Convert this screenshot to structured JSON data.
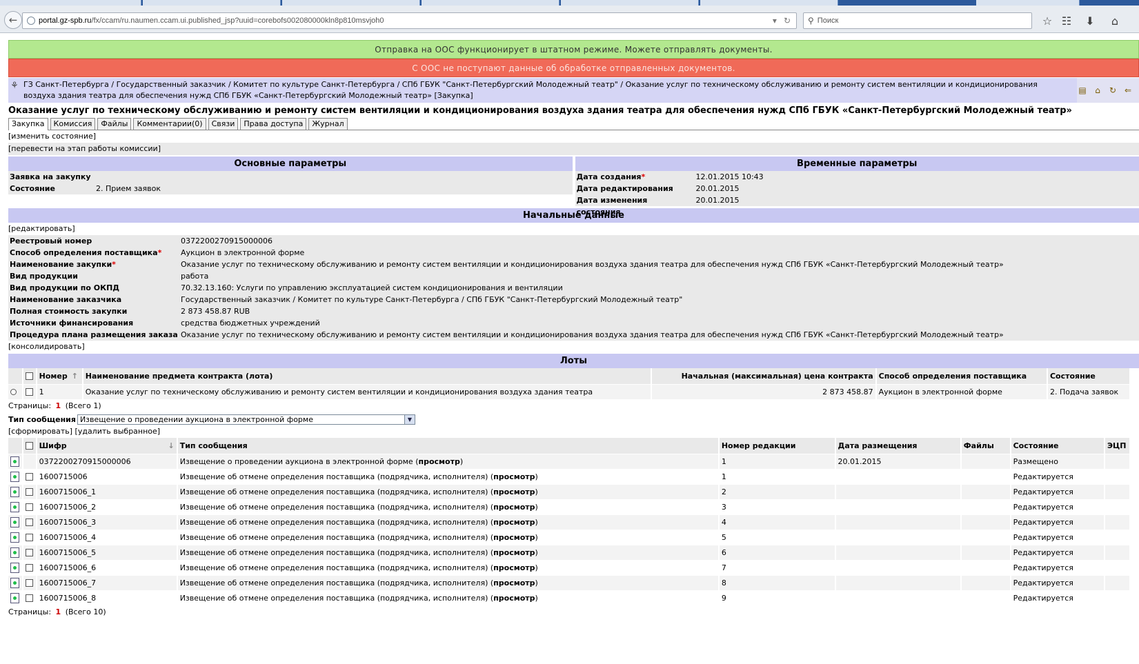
{
  "browser": {
    "url_host": "portal.gz-spb.ru",
    "url_path": "/fx/ccam/ru.naumen.ccam.ui.published_jsp?uuid=corebofs002080000kln8p810msvjoh0",
    "search_placeholder": "Поиск"
  },
  "banners": {
    "ok": "Отправка на ООС функционирует в штатном режиме. Можете отправлять документы.",
    "error": "С ООС не поступают данные об обработке отправленных документов."
  },
  "breadcrumb": "ГЗ Санкт-Петербурга / Государственный заказчик / Комитет по культуре Санкт-Петербурга / СПб ГБУК \"Санкт-Петербургский Молодежный театр\" / Оказание услуг по техническому обслуживанию и ремонту систем вентиляции и кондиционирования воздуха здания театра для обеспечения нужд СПб ГБУК «Санкт-Петербургский Молодежный театр» [Закупка]",
  "page_title": "Оказание услуг по техническому обслуживанию и ремонту систем вентиляции и кондиционирования воздуха здания театра для обеспечения нужд СПб ГБУК «Санкт-Петербургский Молодежный театр»",
  "tabs": [
    "Закупка",
    "Комиссия",
    "Файлы",
    "Комментарии(0)",
    "Связи",
    "Права доступа",
    "Журнал"
  ],
  "actions": {
    "change_state": "[изменить состояние]",
    "to_commission": "[перевести на этап работы комиссии]",
    "edit": "[редактировать]",
    "consolidate": "[консолидировать]",
    "generate": "[сформировать]",
    "delete_selected": "[удалить выбранное]"
  },
  "main_params": {
    "title": "Основные параметры",
    "rows": [
      {
        "k": "Заявка на закупку",
        "v": ""
      },
      {
        "k": "Состояние",
        "v": "2. Прием заявок"
      }
    ]
  },
  "time_params": {
    "title": "Временные параметры",
    "rows": [
      {
        "k": "Дата создания",
        "v": "12.01.2015 10:43",
        "req": true
      },
      {
        "k": "Дата редактирования",
        "v": "20.01.2015"
      },
      {
        "k": "Дата изменения состояния",
        "v": "20.01.2015"
      }
    ]
  },
  "initial": {
    "title": "Начальные данные",
    "rows": [
      {
        "k": "Реестровый номер",
        "v": "0372200270915000006"
      },
      {
        "k": "Способ определения поставщика",
        "v": "Аукцион в электронной форме",
        "req": true
      },
      {
        "k": "Наименование закупки",
        "v": "Оказание услуг по техническому обслуживанию и ремонту систем вентиляции и кондиционирования воздуха здания театра для обеспечения нужд СПб ГБУК «Санкт-Петербургский Молодежный театр»",
        "req": true
      },
      {
        "k": "Вид продукции",
        "v": "работа"
      },
      {
        "k": "Вид продукции по ОКПД",
        "v": "70.32.13.160: Услуги по управлению эксплуатацией систем кондиционирования и вентиляции"
      },
      {
        "k": "Наименование заказчика",
        "v": "Государственный заказчик / Комитет по культуре Санкт-Петербурга / СПб ГБУК \"Санкт-Петербургский Молодежный театр\""
      },
      {
        "k": "Полная стоимость закупки",
        "v": "2 873 458.87 RUB"
      },
      {
        "k": "Источники финансирования",
        "v": "средства бюджетных учреждений"
      },
      {
        "k": "Процедура плана размещения заказа",
        "v": "Оказание услуг по техническому обслуживанию и ремонту систем вентиляции и кондиционирования воздуха здания театра для обеспечения нужд СПб ГБУК «Санкт-Петербургский Молодежный театр»"
      }
    ]
  },
  "lots": {
    "title": "Лоты",
    "headers": [
      "Номер",
      "Наименование предмета контракта (лота)",
      "Начальная (максимальная) цена контракта",
      "Способ определения поставщика",
      "Состояние"
    ],
    "rows": [
      {
        "num": "1",
        "name": "Оказание услуг по техническому обслуживанию и ремонту систем вентиляции и кондиционирования воздуха здания театра",
        "price": "2 873 458.87",
        "method": "Аукцион в электронной форме",
        "state": "2. Подача заявок"
      }
    ],
    "pager": {
      "label": "Страницы:",
      "current": "1",
      "total": "(Всего 1)"
    }
  },
  "message_type": {
    "label": "Тип сообщения",
    "selected": "Извещение о проведении аукциона в электронной форме"
  },
  "messages": {
    "headers": [
      "Шифр",
      "Тип сообщения",
      "Номер редакции",
      "Дата размещения",
      "Файлы",
      "Состояние",
      "ЭЦП"
    ],
    "view_label": "просмотр",
    "rows": [
      {
        "code": "0372200270915000006",
        "type": "Извещение о проведении аукциона в электронной форме",
        "rev": "1",
        "date": "20.01.2015",
        "state": "Размещено",
        "checkbox": false
      },
      {
        "code": "1600715006",
        "type": "Извещение об отмене определения поставщика (подрядчика, исполнителя)",
        "rev": "1",
        "date": "",
        "state": "Редактируется",
        "checkbox": true
      },
      {
        "code": "1600715006_1",
        "type": "Извещение об отмене определения поставщика (подрядчика, исполнителя)",
        "rev": "2",
        "date": "",
        "state": "Редактируется",
        "checkbox": true
      },
      {
        "code": "1600715006_2",
        "type": "Извещение об отмене определения поставщика (подрядчика, исполнителя)",
        "rev": "3",
        "date": "",
        "state": "Редактируется",
        "checkbox": true
      },
      {
        "code": "1600715006_3",
        "type": "Извещение об отмене определения поставщика (подрядчика, исполнителя)",
        "rev": "4",
        "date": "",
        "state": "Редактируется",
        "checkbox": true
      },
      {
        "code": "1600715006_4",
        "type": "Извещение об отмене определения поставщика (подрядчика, исполнителя)",
        "rev": "5",
        "date": "",
        "state": "Редактируется",
        "checkbox": true
      },
      {
        "code": "1600715006_5",
        "type": "Извещение об отмене определения поставщика (подрядчика, исполнителя)",
        "rev": "6",
        "date": "",
        "state": "Редактируется",
        "checkbox": true
      },
      {
        "code": "1600715006_6",
        "type": "Извещение об отмене определения поставщика (подрядчика, исполнителя)",
        "rev": "7",
        "date": "",
        "state": "Редактируется",
        "checkbox": true
      },
      {
        "code": "1600715006_7",
        "type": "Извещение об отмене определения поставщика (подрядчика, исполнителя)",
        "rev": "8",
        "date": "",
        "state": "Редактируется",
        "checkbox": true
      },
      {
        "code": "1600715006_8",
        "type": "Извещение об отмене определения поставщика (подрядчика, исполнителя)",
        "rev": "9",
        "date": "",
        "state": "Редактируется",
        "checkbox": true
      }
    ],
    "pager": {
      "label": "Страницы:",
      "current": "1",
      "total": "(Всего 10)"
    }
  },
  "colors": {
    "ok_banner": "#b3e88f",
    "error_banner": "#f06a58",
    "section_header": "#c8c8f2",
    "breadcrumb_bg": "#d5d5f5"
  }
}
